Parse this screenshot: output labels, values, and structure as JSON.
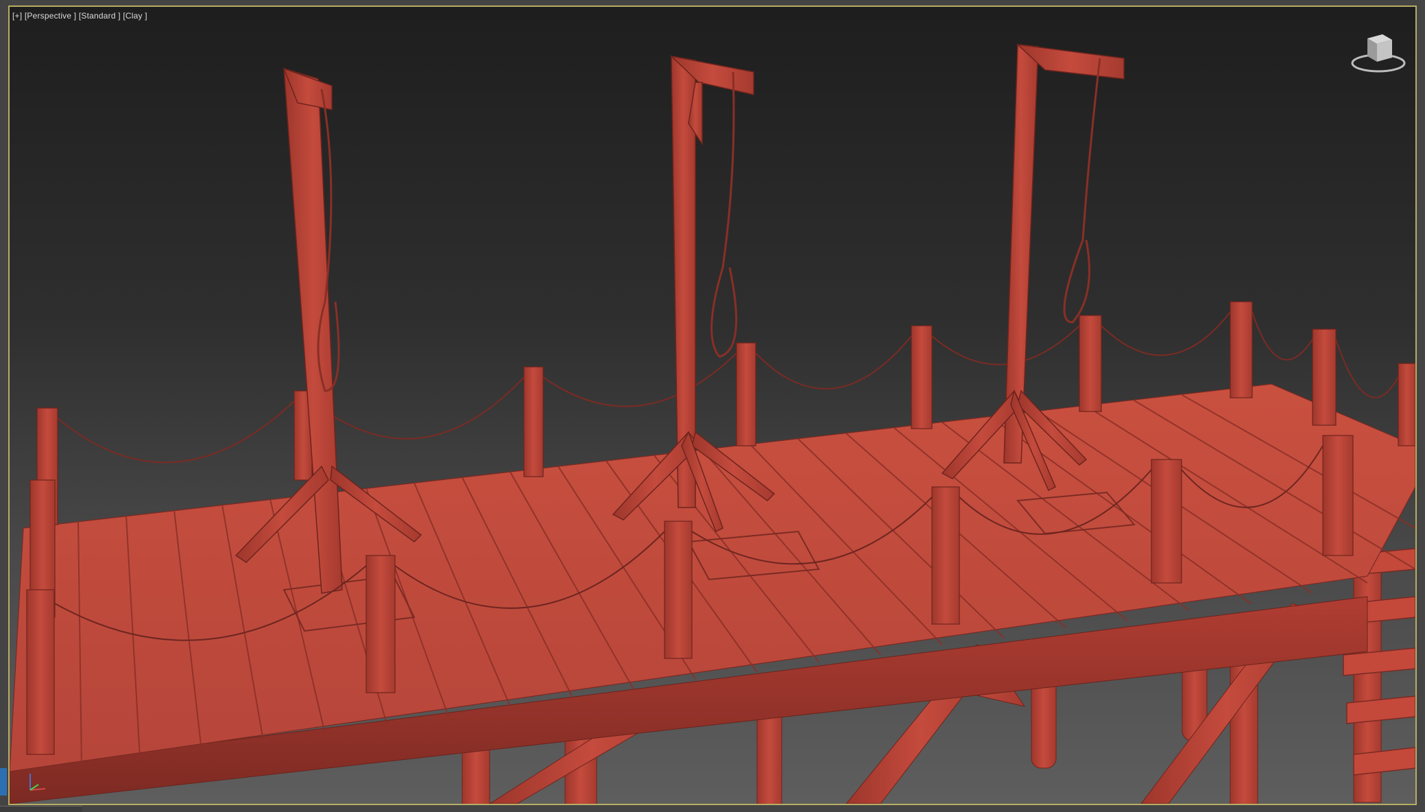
{
  "viewport": {
    "label_plus": "[+]",
    "label_view": "[Perspective ]",
    "label_shading": "[Standard ]",
    "label_style": "[Clay ]"
  },
  "icons": {
    "viewcube": "viewcube-icon",
    "axis": "axis-tripod-icon"
  },
  "colors": {
    "clay": "#c24a3d",
    "clay_dark": "#8f3128",
    "clay_light": "#d2604f",
    "viewport_border": "#b8ad63"
  }
}
